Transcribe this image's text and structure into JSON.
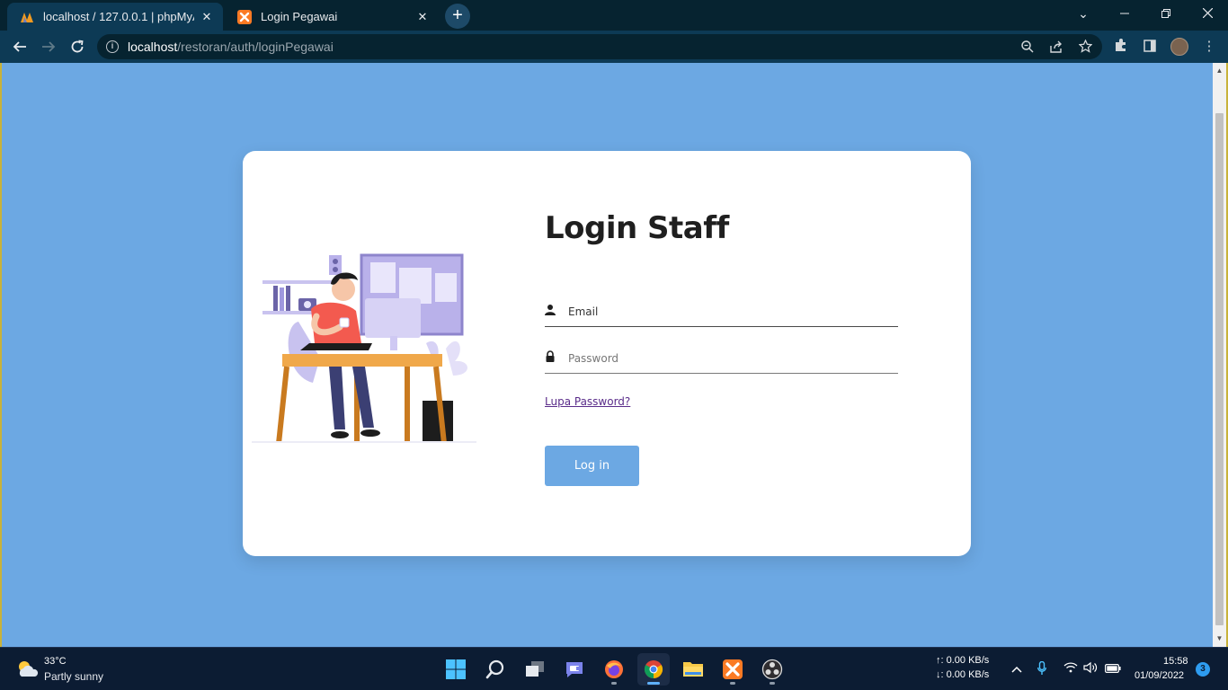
{
  "browser": {
    "tabs": [
      {
        "title": "localhost / 127.0.0.1 | phpMyAdmin",
        "active": true,
        "icon": "phpmyadmin-icon"
      },
      {
        "title": "Login Pegawai",
        "active": false,
        "icon": "xampp-icon"
      }
    ],
    "url_host": "localhost",
    "url_path": "/restoran/auth/loginPegawai"
  },
  "page": {
    "title": "Login Staff",
    "email_placeholder": "Email",
    "password_placeholder": "Password",
    "forgot_link": "Lupa Password?",
    "login_button": "Log in",
    "background_color": "#6ca8e3"
  },
  "taskbar": {
    "weather_temp": "33°C",
    "weather_desc": "Partly sunny",
    "upload_speed": "↑: 0.00 KB/s",
    "download_speed": "↓: 0.00 KB/s",
    "time": "15:58",
    "date": "01/09/2022",
    "notification_count": "3"
  }
}
